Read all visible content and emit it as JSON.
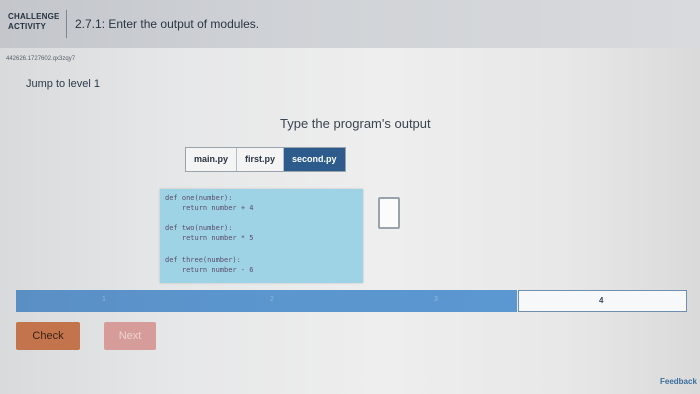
{
  "header": {
    "challenge_line1": "CHALLENGE",
    "challenge_line2": "ACTIVITY",
    "title": "2.7.1: Enter the output of modules."
  },
  "session_id": "442626.1727602.qx3zqy7",
  "jump_link": "Jump to level 1",
  "output_heading": "Type the program's output",
  "tabs": [
    {
      "label": "main.py",
      "active": false
    },
    {
      "label": "first.py",
      "active": false
    },
    {
      "label": "second.py",
      "active": true
    }
  ],
  "code_lines": [
    "def one(number):",
    "    return number + 4",
    "def two(number):",
    "    return number * 5",
    "def three(number):",
    "    return number - 6"
  ],
  "output_value": "",
  "progress": {
    "level_labels": [
      "1",
      "2",
      "3",
      "4"
    ],
    "current_level": "4"
  },
  "buttons": {
    "check": "Check",
    "next": "Next"
  },
  "feedback": "Feedback",
  "colors": {
    "tab_active": "#2d5c8c",
    "code_bg": "#9ed3e6",
    "progress_fill": "#5b95cd",
    "check_button": "#c4744c",
    "next_button": "#d69c9a"
  }
}
